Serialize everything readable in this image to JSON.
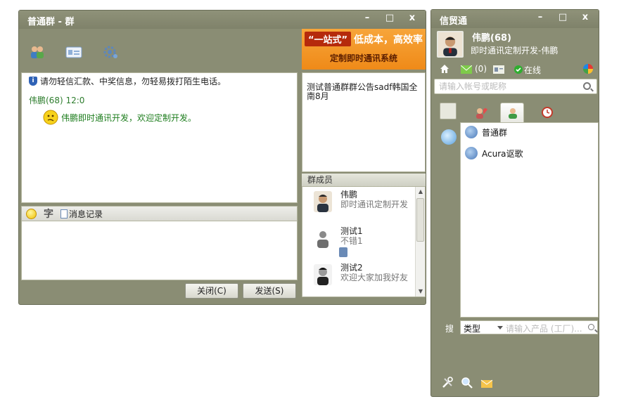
{
  "chat_window": {
    "title": "普通群 - 群",
    "minimize": "–",
    "maximize": "□",
    "close": "x",
    "ad": {
      "tag": "“一站式”",
      "slogan": "低成本，高效率",
      "subtitle": "定制即时通讯系统"
    },
    "notice": "请勿轻信汇款、中奖信息，勿轻易拨打陌生电话。",
    "message": {
      "sender": "伟鹏(68) 12:0",
      "text": "伟鹏即时通讯开发，欢迎定制开发。"
    },
    "input_toolbar": {
      "font_label": "字",
      "history_label": "消息记录"
    },
    "buttons": {
      "close": "关闭(C)",
      "send": "发送(S)"
    },
    "announcement": "测试普通群群公告sadf韩国全南8月",
    "members_header": "群成员",
    "members": [
      {
        "name": "伟鹏",
        "signature": "即时通讯定制开发"
      },
      {
        "name": "测试1",
        "signature": "不错1"
      },
      {
        "name": "测试2",
        "signature": "欢迎大家加我好友"
      }
    ]
  },
  "main_window": {
    "title": "信贸通",
    "minimize": "–",
    "maximize": "□",
    "close": "x",
    "profile": {
      "nickname": "伟鹏(68)",
      "signature": "即时通讯定制开发-伟鹏"
    },
    "status": {
      "mail_count": "(0)",
      "presence": "在线"
    },
    "search_placeholder": "请输入帐号或昵称",
    "groups": [
      {
        "name": "普通群"
      },
      {
        "name": "Acura讴歌"
      }
    ],
    "product_search": {
      "label": "搜",
      "type_label": "类型",
      "placeholder": "请输入产品 (工厂)..."
    }
  }
}
